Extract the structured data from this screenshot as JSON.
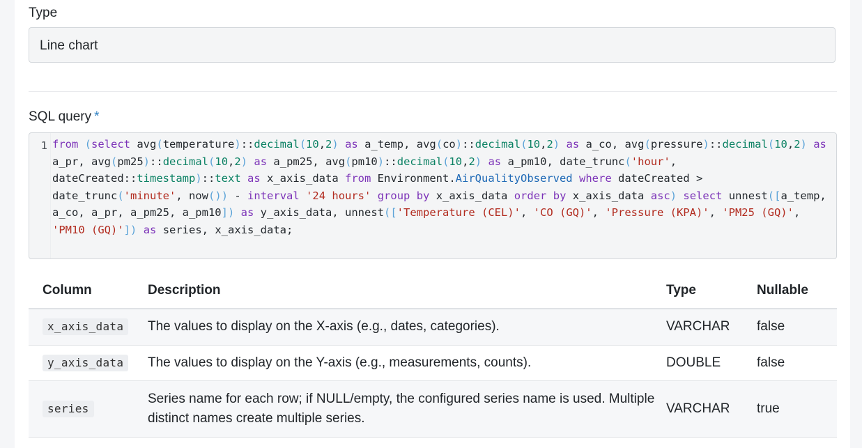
{
  "type_field": {
    "label": "Type",
    "value": "Line chart"
  },
  "sql_field": {
    "label": "SQL query",
    "required_marker": "*",
    "line_number": "1",
    "query": "from (select avg(temperature)::decimal(10,2) as a_temp, avg(co)::decimal(10,2) as a_co, avg(pressure)::decimal(10,2) as a_pr, avg(pm25)::decimal(10,2) as a_pm25, avg(pm10)::decimal(10,2) as a_pm10, date_trunc('hour', dateCreated::timestamp)::text as x_axis_data from Environment.AirQualityObserved where dateCreated > date_trunc('minute', now()) - interval '24 hours' group by x_axis_data order by x_axis_data asc) select unnest([a_temp, a_co, a_pr, a_pm25, a_pm10]) as y_axis_data, unnest(['Temperature (CEL)', 'CO (GQ)', 'Pressure (KPA)', 'PM25 (GQ)', 'PM10 (GQ)']) as series, x_axis_data;"
  },
  "columns_table": {
    "headers": [
      "Column",
      "Description",
      "Type",
      "Nullable"
    ],
    "rows": [
      {
        "column": "x_axis_data",
        "description": "The values to display on the X-axis (e.g., dates, categories).",
        "type": "VARCHAR",
        "nullable": "false"
      },
      {
        "column": "y_axis_data",
        "description": "The values to display on the Y-axis (e.g., measurements, counts).",
        "type": "DOUBLE",
        "nullable": "false"
      },
      {
        "column": "series",
        "description": "Series name for each row; if NULL/empty, the configured series name is used. Multiple distinct names create multiple series.",
        "type": "VARCHAR",
        "nullable": "true"
      }
    ]
  }
}
